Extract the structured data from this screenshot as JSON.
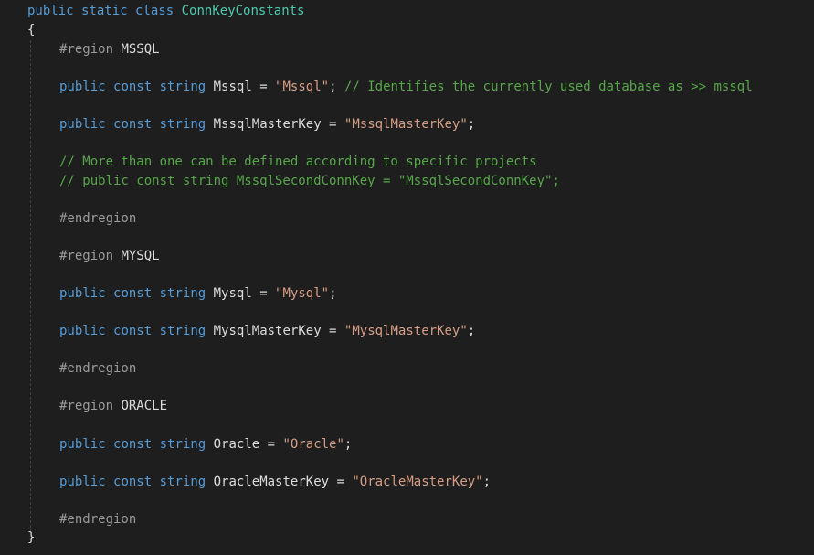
{
  "colors": {
    "background": "#1e1e1e",
    "keyword": "#569cd6",
    "type": "#4ec9b0",
    "string": "#d69d85",
    "comment": "#57a64a",
    "preprocessor": "#9b9b9b",
    "text": "#dcdcdc"
  },
  "code": {
    "lines": [
      [
        {
          "t": "kw",
          "s": "public"
        },
        {
          "t": "txt",
          "s": " "
        },
        {
          "t": "kw",
          "s": "static"
        },
        {
          "t": "txt",
          "s": " "
        },
        {
          "t": "kw",
          "s": "class"
        },
        {
          "t": "txt",
          "s": " "
        },
        {
          "t": "type",
          "s": "ConnKeyConstants"
        }
      ],
      [
        {
          "t": "txt",
          "s": "{"
        }
      ],
      [
        {
          "t": "pp",
          "s": "#region"
        },
        {
          "t": "txt",
          "s": " MSSQL"
        }
      ],
      [
        {
          "t": "kw",
          "s": "public"
        },
        {
          "t": "txt",
          "s": " "
        },
        {
          "t": "kw",
          "s": "const"
        },
        {
          "t": "txt",
          "s": " "
        },
        {
          "t": "kw",
          "s": "string"
        },
        {
          "t": "txt",
          "s": " Mssql = "
        },
        {
          "t": "str",
          "s": "\"Mssql\""
        },
        {
          "t": "txt",
          "s": "; "
        },
        {
          "t": "cm",
          "s": "// Identifies the currently used database as >> mssql"
        }
      ],
      [
        {
          "t": "kw",
          "s": "public"
        },
        {
          "t": "txt",
          "s": " "
        },
        {
          "t": "kw",
          "s": "const"
        },
        {
          "t": "txt",
          "s": " "
        },
        {
          "t": "kw",
          "s": "string"
        },
        {
          "t": "txt",
          "s": " MssqlMasterKey = "
        },
        {
          "t": "str",
          "s": "\"MssqlMasterKey\""
        },
        {
          "t": "txt",
          "s": ";"
        }
      ],
      [
        {
          "t": "cm",
          "s": "// More than one can be defined according to specific projects"
        }
      ],
      [
        {
          "t": "cm",
          "s": "// public const string MssqlSecondConnKey = \"MssqlSecondConnKey\";"
        }
      ],
      [
        {
          "t": "pp",
          "s": "#endregion"
        }
      ],
      [
        {
          "t": "pp",
          "s": "#region"
        },
        {
          "t": "txt",
          "s": " MYSQL"
        }
      ],
      [
        {
          "t": "kw",
          "s": "public"
        },
        {
          "t": "txt",
          "s": " "
        },
        {
          "t": "kw",
          "s": "const"
        },
        {
          "t": "txt",
          "s": " "
        },
        {
          "t": "kw",
          "s": "string"
        },
        {
          "t": "txt",
          "s": " Mysql = "
        },
        {
          "t": "str",
          "s": "\"Mysql\""
        },
        {
          "t": "txt",
          "s": ";"
        }
      ],
      [
        {
          "t": "kw",
          "s": "public"
        },
        {
          "t": "txt",
          "s": " "
        },
        {
          "t": "kw",
          "s": "const"
        },
        {
          "t": "txt",
          "s": " "
        },
        {
          "t": "kw",
          "s": "string"
        },
        {
          "t": "txt",
          "s": " MysqlMasterKey = "
        },
        {
          "t": "str",
          "s": "\"MysqlMasterKey\""
        },
        {
          "t": "txt",
          "s": ";"
        }
      ],
      [
        {
          "t": "pp",
          "s": "#endregion"
        }
      ],
      [
        {
          "t": "pp",
          "s": "#region"
        },
        {
          "t": "txt",
          "s": " ORACLE"
        }
      ],
      [
        {
          "t": "kw",
          "s": "public"
        },
        {
          "t": "txt",
          "s": " "
        },
        {
          "t": "kw",
          "s": "const"
        },
        {
          "t": "txt",
          "s": " "
        },
        {
          "t": "kw",
          "s": "string"
        },
        {
          "t": "txt",
          "s": " Oracle = "
        },
        {
          "t": "str",
          "s": "\"Oracle\""
        },
        {
          "t": "txt",
          "s": ";"
        }
      ],
      [
        {
          "t": "kw",
          "s": "public"
        },
        {
          "t": "txt",
          "s": " "
        },
        {
          "t": "kw",
          "s": "const"
        },
        {
          "t": "txt",
          "s": " "
        },
        {
          "t": "kw",
          "s": "string"
        },
        {
          "t": "txt",
          "s": " OracleMasterKey = "
        },
        {
          "t": "str",
          "s": "\"OracleMasterKey\""
        },
        {
          "t": "txt",
          "s": ";"
        }
      ],
      [
        {
          "t": "pp",
          "s": "#endregion"
        }
      ],
      [
        {
          "t": "txt",
          "s": "}"
        }
      ]
    ]
  }
}
